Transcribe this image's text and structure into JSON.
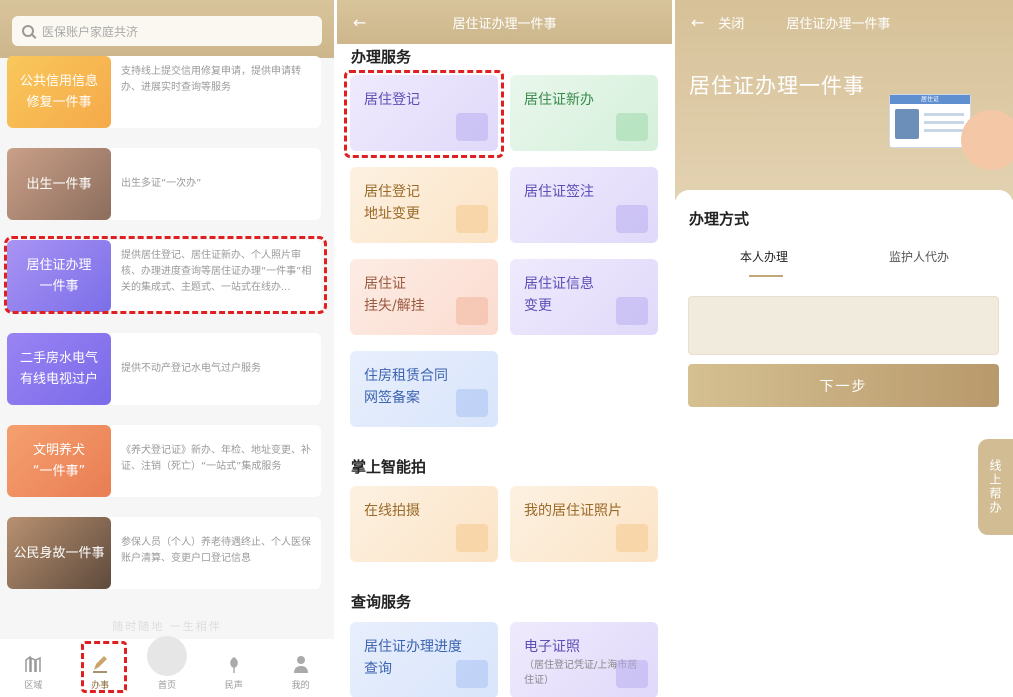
{
  "panel1": {
    "search_placeholder": "医保账户家庭共济",
    "cards": [
      {
        "title_line1": "公共信用信息",
        "title_line2": "修复一件事",
        "desc": "支持线上提交信用修复申请，提供申请转办、进展实时查询等服务"
      },
      {
        "title_line1": "出生一件事",
        "title_line2": "",
        "desc": "出生多证“一次办”"
      },
      {
        "title_line1": "居住证办理",
        "title_line2": "一件事",
        "desc": "提供居住登记、居住证新办、个人照片审核、办理进度查询等居住证办理“一件事”相关的集成式、主题式、一站式在线办..."
      },
      {
        "title_line1": "二手房水电气",
        "title_line2": "有线电视过户",
        "desc": "提供不动产登记水电气过户服务"
      },
      {
        "title_line1": "文明养犬",
        "title_line2": "“一件事”",
        "desc": "《养犬登记证》新办、年检、地址变更、补证、注销（死亡）“一站式”集成服务"
      },
      {
        "title_line1": "公民身故一件事",
        "title_line2": "",
        "desc": "参保人员（个人）养老待遇终止、个人医保账户清算、变更户口登记信息"
      }
    ],
    "slogan": "随时随地 一生相伴",
    "nav": [
      {
        "label": "区域",
        "icon": "region-icon"
      },
      {
        "label": "办事",
        "icon": "pen-icon"
      },
      {
        "label": "首页",
        "icon": "home-icon"
      },
      {
        "label": "民声",
        "icon": "tulip-icon"
      },
      {
        "label": "我的",
        "icon": "person-icon"
      }
    ]
  },
  "panel2": {
    "title": "居住证办理一件事",
    "section1": "办理服务",
    "tiles1": [
      {
        "line1": "居住登记",
        "line2": ""
      },
      {
        "line1": "居住证新办",
        "line2": ""
      },
      {
        "line1": "居住登记",
        "line2": "地址变更"
      },
      {
        "line1": "居住证签注",
        "line2": ""
      },
      {
        "line1": "居住证",
        "line2": "挂失/解挂"
      },
      {
        "line1": "居住证信息",
        "line2": "变更"
      },
      {
        "line1": "住房租赁合同",
        "line2": "网签备案"
      }
    ],
    "section2": "掌上智能拍",
    "tiles2": [
      {
        "line1": "在线拍摄",
        "line2": ""
      },
      {
        "line1": "我的居住证照片",
        "line2": ""
      }
    ],
    "section3": "查询服务",
    "tiles3": [
      {
        "line1": "居住证办理进度",
        "line2": "查询"
      },
      {
        "line1": "电子证照",
        "sub": "（居住登记凭证/上海市居住证）"
      }
    ]
  },
  "panel3": {
    "back_label": "←",
    "close_label": "关闭",
    "nav_title": "居住证办理一件事",
    "hero_title": "居住证办理一件事",
    "card_header": "居住证",
    "sheet_title": "办理方式",
    "tab_self": "本人办理",
    "tab_guardian": "监护人代办",
    "next_label": "下一步",
    "help_label": "线上帮办"
  },
  "colors": {
    "gold": "#cdb68c",
    "highlight": "#e02020"
  }
}
